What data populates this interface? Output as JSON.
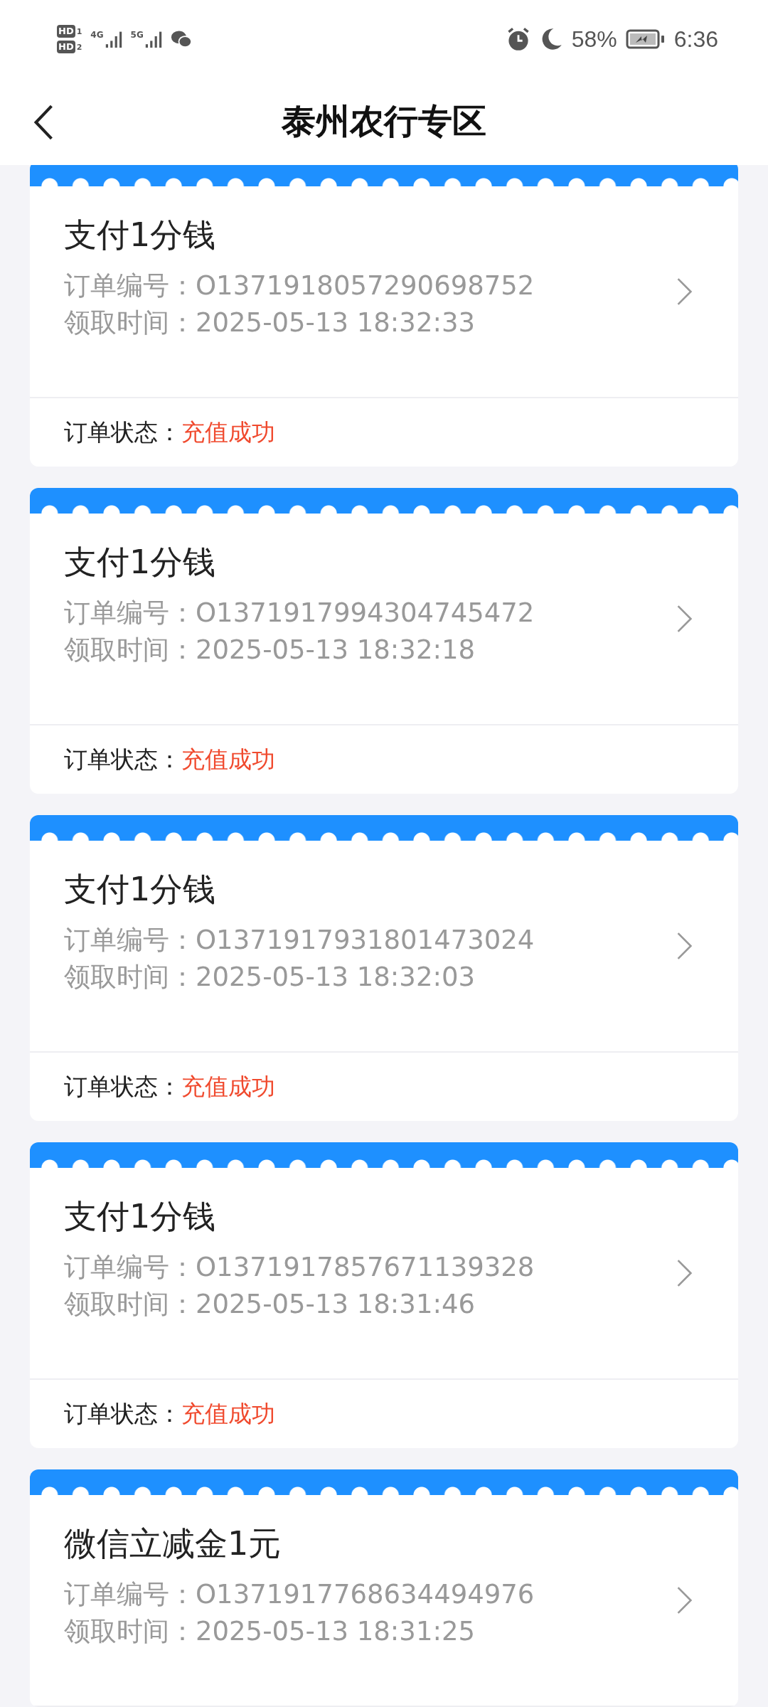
{
  "status_bar": {
    "sim_badges": [
      {
        "label": "HD",
        "slot": "1"
      },
      {
        "label": "HD",
        "slot": "2"
      }
    ],
    "networks": [
      "4G",
      "5G"
    ],
    "battery": "58%",
    "time": "6:36"
  },
  "header": {
    "title": "泰州农行专区"
  },
  "orders": [
    {
      "title": "支付1分钱",
      "number_label": "订单编号：",
      "number": "O1371918057290698752",
      "time_label": "领取时间：",
      "time": "2025-05-13 18:32:33",
      "status_label": "订单状态：",
      "status": "充值成功"
    },
    {
      "title": "支付1分钱",
      "number_label": "订单编号：",
      "number": "O1371917994304745472",
      "time_label": "领取时间：",
      "time": "2025-05-13 18:32:18",
      "status_label": "订单状态：",
      "status": "充值成功"
    },
    {
      "title": "支付1分钱",
      "number_label": "订单编号：",
      "number": "O1371917931801473024",
      "time_label": "领取时间：",
      "time": "2025-05-13 18:32:03",
      "status_label": "订单状态：",
      "status": "充值成功"
    },
    {
      "title": "支付1分钱",
      "number_label": "订单编号：",
      "number": "O1371917857671139328",
      "time_label": "领取时间：",
      "time": "2025-05-13 18:31:46",
      "status_label": "订单状态：",
      "status": "充值成功"
    },
    {
      "title": "微信立减金1元",
      "number_label": "订单编号：",
      "number": "O1371917768634494976",
      "time_label": "领取时间：",
      "time": "2025-05-13 18:31:25"
    }
  ]
}
